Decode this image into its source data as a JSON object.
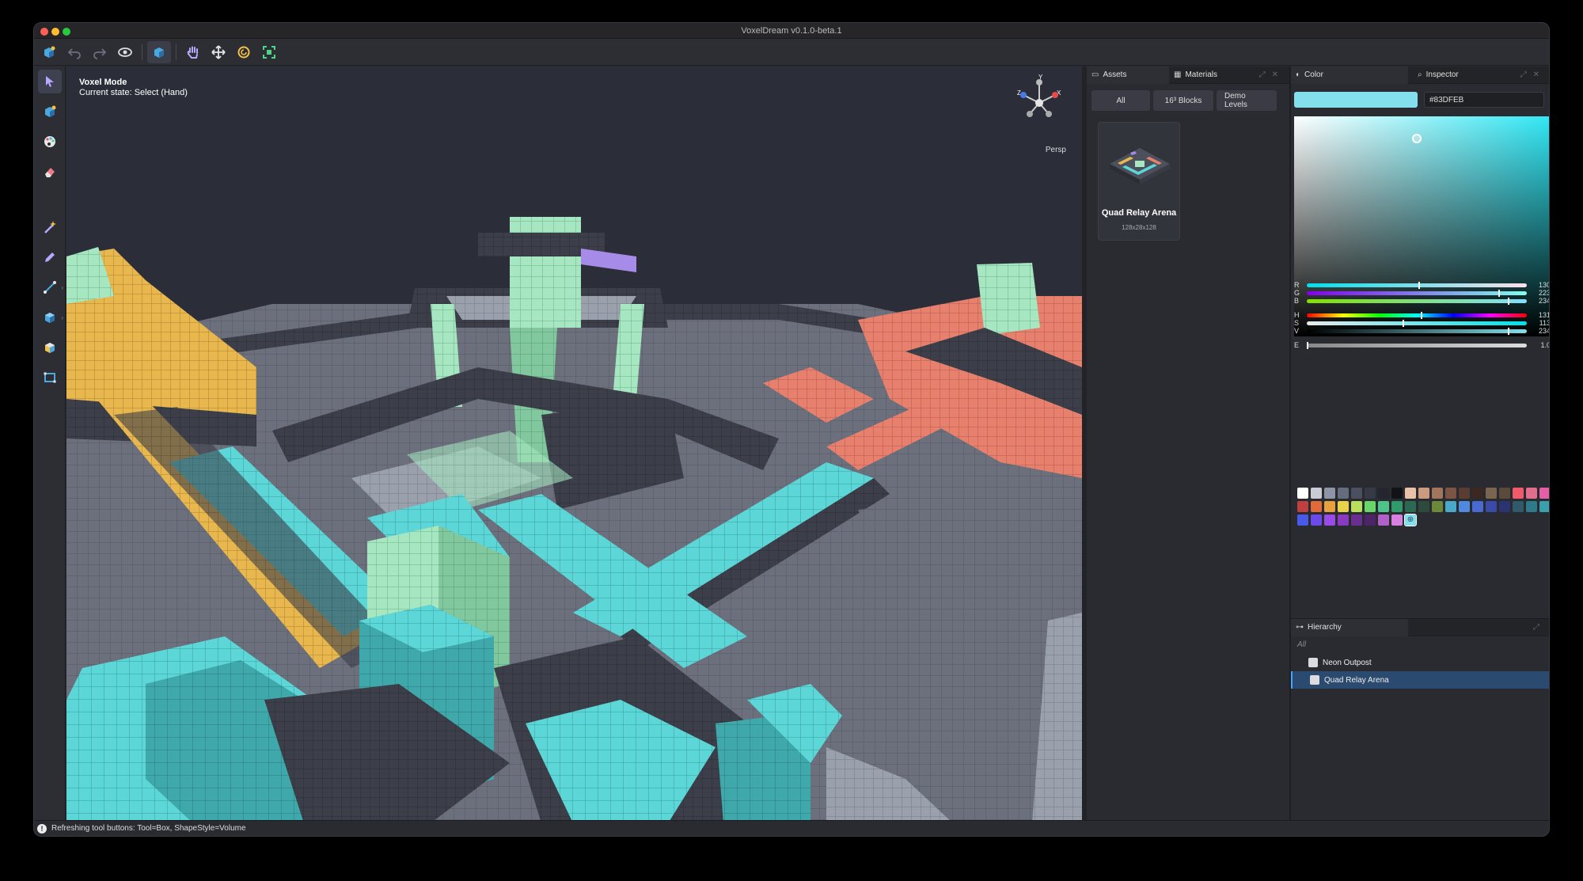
{
  "window": {
    "title": "VoxelDream v0.1.0-beta.1"
  },
  "toolbar": {
    "items": [
      "app-icon",
      "undo-icon",
      "redo-icon",
      "eye-icon",
      "cube-view-icon",
      "hand-icon",
      "move-icon",
      "rotate-icon",
      "fit-icon"
    ]
  },
  "left_tools": [
    "select-arrow-icon",
    "voxel-cube-icon",
    "palette-icon",
    "eraser-icon",
    "magic-wand-icon",
    "pencil-icon",
    "line-icon",
    "box-icon",
    "cube-shape-icon",
    "rectangle-icon"
  ],
  "viewport": {
    "mode": "Voxel Mode",
    "state": "Current state: Select (Hand)",
    "projection": "Persp",
    "gizmo_labels": {
      "y": "Y",
      "x": "X",
      "z": "Z"
    }
  },
  "assets_panel": {
    "tab_assets": "Assets",
    "tab_materials": "Materials",
    "filters": [
      "All",
      "16³ Blocks",
      "Demo Levels"
    ],
    "card": {
      "name": "Quad Relay Arena",
      "size": "128x28x128"
    }
  },
  "color_panel": {
    "tab_color": "Color",
    "tab_inspector": "Inspector",
    "hex": "#83DFEB",
    "current_color": "#83DFEB",
    "sliders": [
      {
        "label": "R",
        "value": "130",
        "fraction": 0.51
      },
      {
        "label": "G",
        "value": "223",
        "fraction": 0.875
      },
      {
        "label": "B",
        "value": "234",
        "fraction": 0.92
      },
      {
        "label": "H",
        "value": "131",
        "fraction": 0.52
      },
      {
        "label": "S",
        "value": "113",
        "fraction": 0.44
      },
      {
        "label": "V",
        "value": "234",
        "fraction": 0.92
      },
      {
        "label": "E",
        "value": "1.0",
        "fraction": 0.0
      }
    ],
    "palette": [
      [
        "#ffffff",
        "#c9ccd6",
        "#8e95a6",
        "#656c7c",
        "#4a5060",
        "#353a46",
        "#23262e",
        "#121317",
        "#e9c3a8",
        "#c99c80",
        "#a1765c",
        "#7a5544",
        "#5a3c31",
        "#3b2823",
        "#7a6550",
        "#5a4a3c",
        "#f05a6a",
        "#e06f8e",
        "#e45fa8",
        "#d66ad0"
      ],
      [
        "#c04040",
        "#e06a3a",
        "#e8a13c",
        "#e8d24a",
        "#b8e05a",
        "#68d66a",
        "#4cc48a",
        "#2f9a6a",
        "#2a6a52",
        "#2e4a3c",
        "#6a8a3a",
        "#4aa8c8",
        "#4e8ae0",
        "#4a6ad0",
        "#3a4aa8",
        "#2a3470",
        "#2e5a6a",
        "#2e7a8a",
        "#3aa0b0",
        "#4ab8c8"
      ],
      [
        "#4a5ae8",
        "#6a4ae8",
        "#9a4ae8",
        "#8a3ac0",
        "#6a2e90",
        "#4e2468",
        "#b060c8",
        "#d880e0",
        "#83dfeb"
      ]
    ]
  },
  "hierarchy": {
    "title": "Hierarchy",
    "filter": "All",
    "items": [
      {
        "name": "Neon Outpost",
        "selected": false
      },
      {
        "name": "Quad Relay Arena",
        "selected": true
      }
    ]
  },
  "status": {
    "message": "Refreshing tool buttons: Tool=Box, ShapeStyle=Volume"
  }
}
